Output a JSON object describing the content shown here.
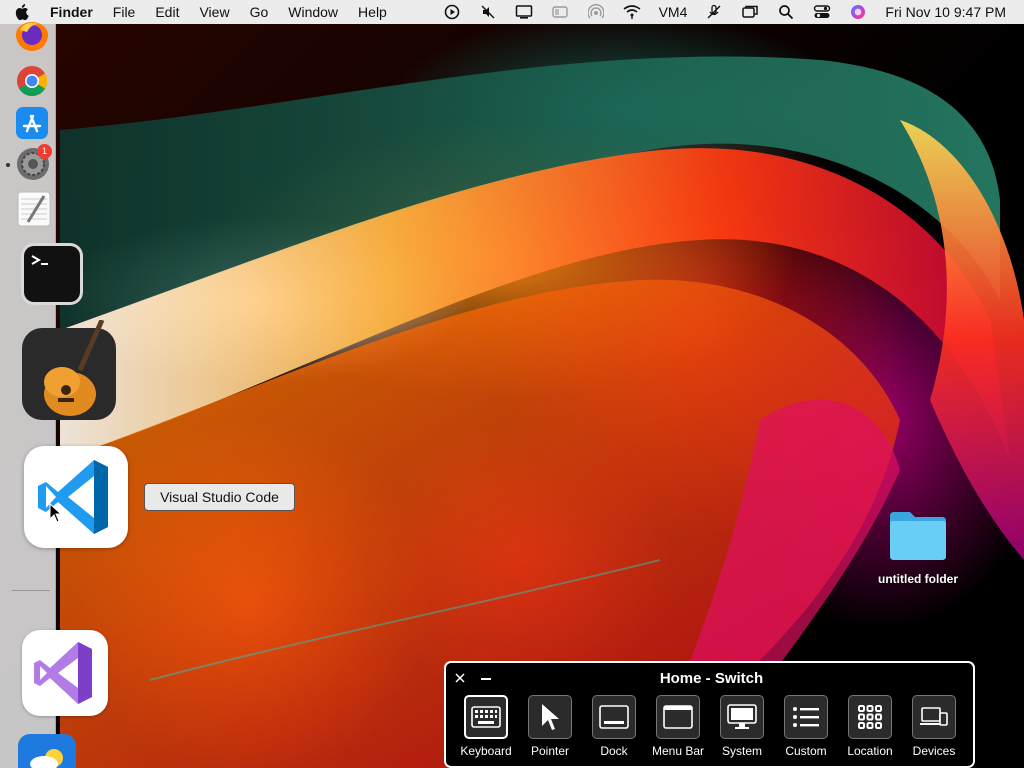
{
  "menubar": {
    "apple_icon": "apple-icon",
    "app_name": "Finder",
    "menus": [
      "File",
      "Edit",
      "View",
      "Go",
      "Window",
      "Help"
    ],
    "status_icons": [
      "play-circle-icon",
      "mute-icon",
      "display-icon",
      "window-icon",
      "airdrop-icon",
      "wifi-icon"
    ],
    "vpn_label": "VM4",
    "status_icons_right": [
      "no-microphone-icon",
      "screen-mirroring-icon",
      "spotlight-search-icon",
      "control-center-icon",
      "siri-icon"
    ],
    "datetime": "Fri Nov 10  9:47 PM"
  },
  "dock": {
    "apps": [
      "Firefox",
      "Google Chrome",
      "App Store",
      "System Preferences",
      "TextEdit",
      "Terminal",
      "GarageBand",
      "Visual Studio Code",
      "Visual Studio",
      "Weather"
    ],
    "notification_badge": "1",
    "tooltip": "Visual Studio Code"
  },
  "desktop": {
    "folder_label": "untitled folder"
  },
  "panel": {
    "title": "Home - Switch",
    "buttons": [
      "Keyboard",
      "Pointer",
      "Dock",
      "Menu Bar",
      "System",
      "Custom",
      "Location",
      "Devices"
    ],
    "active_button": "Keyboard"
  },
  "colors": {
    "menubar_bg": "#ececec",
    "panel_bg": "#000000",
    "folder_blue": "#5ac4f0",
    "vscode_blue": "#0065a9"
  }
}
